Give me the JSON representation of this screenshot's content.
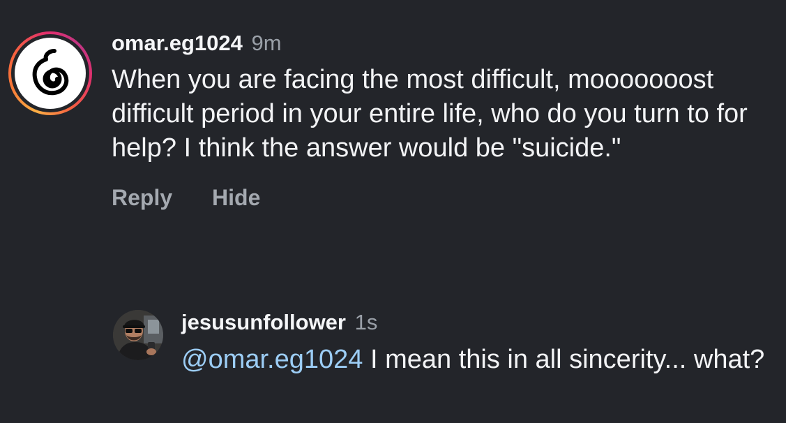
{
  "comment": {
    "username": "omar.eg1024",
    "time": "9m",
    "text": "When you are facing the most difficult, mooooooost difficult period in your entire life, who do you turn to for help? I think the answer would be \"suicide.\"",
    "reply_label": "Reply",
    "hide_label": "Hide",
    "avatar_icon": "logo-icon"
  },
  "reply": {
    "username": "jesusunfollower",
    "time": "1s",
    "mention": "@omar.eg1024",
    "text": " I mean this in all sincerity... what?",
    "avatar_icon": "profile-photo"
  },
  "colors": {
    "background": "#23252a",
    "mention": "#9ccdf5",
    "secondary_text": "#9aa0a8"
  }
}
